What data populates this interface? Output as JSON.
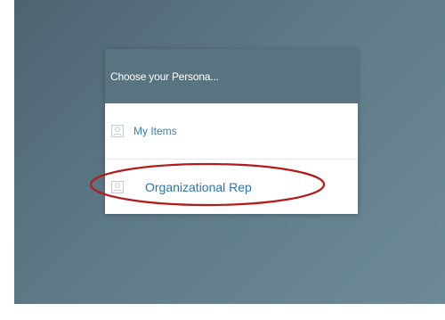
{
  "dialog": {
    "title": "Choose your Persona...",
    "options": [
      {
        "label": "My Items",
        "icon": "person-icon"
      },
      {
        "label": "Organizational Rep",
        "icon": "person-icon"
      }
    ]
  },
  "annotation": {
    "type": "ellipse-highlight",
    "target": "Organizational Rep",
    "color": "#b31b1b"
  },
  "colors": {
    "background": "#5e7a87",
    "header": "#587480",
    "link": "#2f7fb7"
  }
}
